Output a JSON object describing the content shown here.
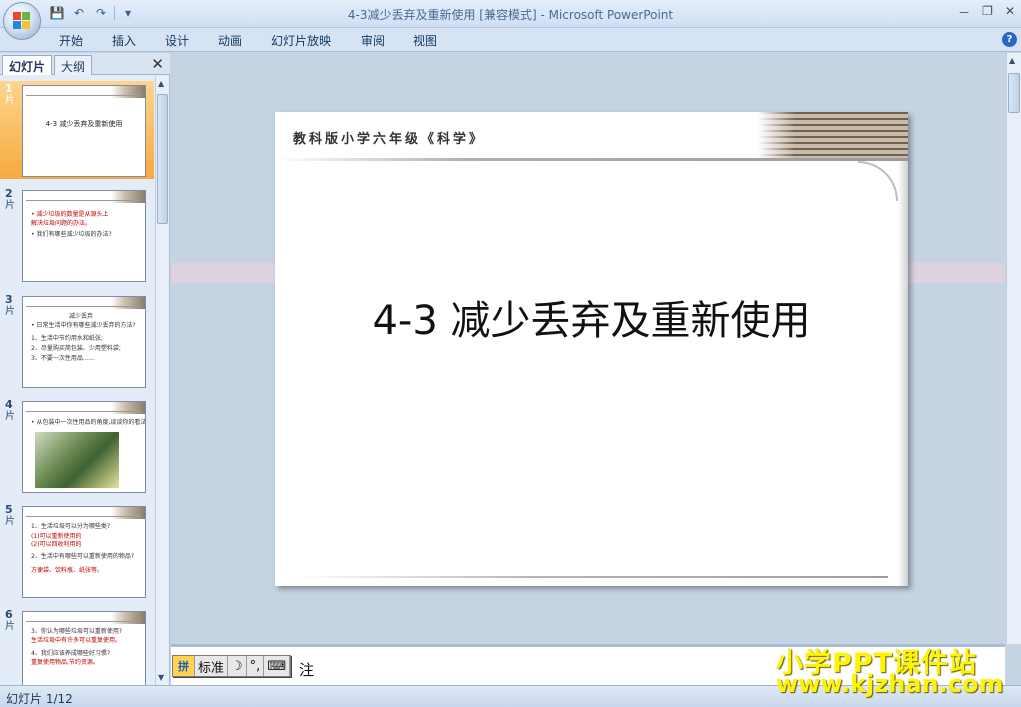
{
  "window": {
    "title": "4-3减少丢弃及重新使用 [兼容模式] - Microsoft PowerPoint",
    "minimize": "－",
    "restore": "❐",
    "close": "✕"
  },
  "ribbon": {
    "tabs": [
      "开始",
      "插入",
      "设计",
      "动画",
      "幻灯片放映",
      "审阅",
      "视图"
    ]
  },
  "left_panel": {
    "tabs": [
      "幻灯片",
      "大纲"
    ],
    "close": "✕",
    "slide_label": "片",
    "thumbnails": [
      {
        "num": "1",
        "title": "4-3 减少丢弃及重新使用"
      },
      {
        "num": "2",
        "lines": [
          "• 减少垃圾的数量是从源头上",
          "  解决垃圾问题的办法。",
          "• 我们有哪些减少垃圾的办法?"
        ]
      },
      {
        "num": "3",
        "heading": "减少丢弃",
        "lines": [
          "• 日常生活中你有哪些减少丢弃的方法?",
          "1、生活中节约用水和纸张;",
          "2、尽量购买简包装、少用塑料袋;",
          "3、不要一次性用品……"
        ]
      },
      {
        "num": "4",
        "lines": [
          "• 从包装中一次性用品的角度,谈谈你的看法。"
        ]
      },
      {
        "num": "5",
        "lines": [
          "1、生活垃圾可以分为哪些类?",
          "(1)可以重新使用的",
          "(2)可以回收利用的",
          "2、生活中有哪些可以重新使用的物品?",
          "方便袋、饮料瓶、纸张等。"
        ]
      },
      {
        "num": "6",
        "lines": [
          "3、你认为哪些垃圾可以重新使用?",
          "生活垃圾中有许多可以重复使用。",
          "4、我们应该养成哪些好习惯?",
          "重复使用物品,节约资源。"
        ]
      }
    ]
  },
  "slide": {
    "subject": "教科版小学六年级《科学》",
    "title": "4-3 减少丢弃及重新使用"
  },
  "notes": {
    "text": "注"
  },
  "ime": {
    "logo": "拼",
    "mode": "标准",
    "moon": "☽",
    "punct": "°,",
    "keyboard": "⌨"
  },
  "status": {
    "text": "幻灯片 1/12"
  },
  "watermark": {
    "line1": "小学PPT课件站",
    "line2": "www.kjzhan.com"
  }
}
